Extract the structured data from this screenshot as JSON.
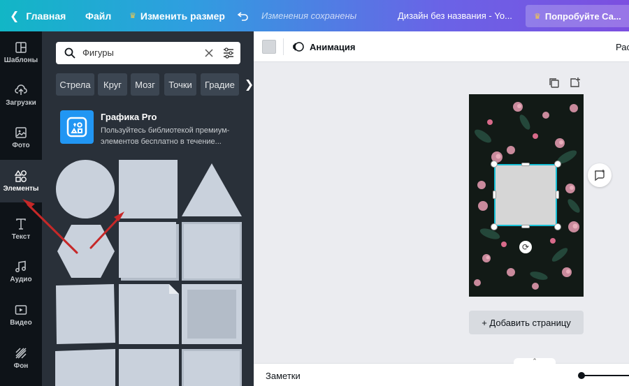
{
  "topbar": {
    "home": "Главная",
    "file": "Файл",
    "resize": "Изменить размер",
    "saved_status": "Изменения сохранены",
    "doc_title": "Дизайн без названия - Yo...",
    "try_button": "Попробуйте Са...",
    "gradient_colors": [
      "#12b6c6",
      "#6a63e6",
      "#7c4fe0"
    ]
  },
  "rail": {
    "items": [
      {
        "label": "Шаблоны",
        "icon": "templates-icon"
      },
      {
        "label": "Загрузки",
        "icon": "upload-icon"
      },
      {
        "label": "Фото",
        "icon": "photo-icon"
      },
      {
        "label": "Элементы",
        "icon": "elements-icon"
      },
      {
        "label": "Текст",
        "icon": "text-icon"
      },
      {
        "label": "Аудио",
        "icon": "audio-icon"
      },
      {
        "label": "Видео",
        "icon": "video-icon"
      },
      {
        "label": "Фон",
        "icon": "background-icon"
      }
    ],
    "active": "Элементы"
  },
  "panel": {
    "search_value": "Фигуры",
    "chips": [
      "Стрела",
      "Круг",
      "Мозг",
      "Точки",
      "Градие"
    ],
    "promo": {
      "title": "Графика Pro",
      "text": "Пользуйтесь библиотекой премиум-элементов бесплатно в течение..."
    }
  },
  "editor": {
    "animation_label": "Анимация",
    "cut_label": "Рас",
    "add_page": "+ Добавить страницу",
    "notes_label": "Заметки"
  },
  "colors": {
    "accent": "#18c0d6",
    "rail_bg": "#0e1318",
    "panel_bg": "#293039",
    "shape": "#c9d1dc",
    "arrow": "#e53935"
  }
}
